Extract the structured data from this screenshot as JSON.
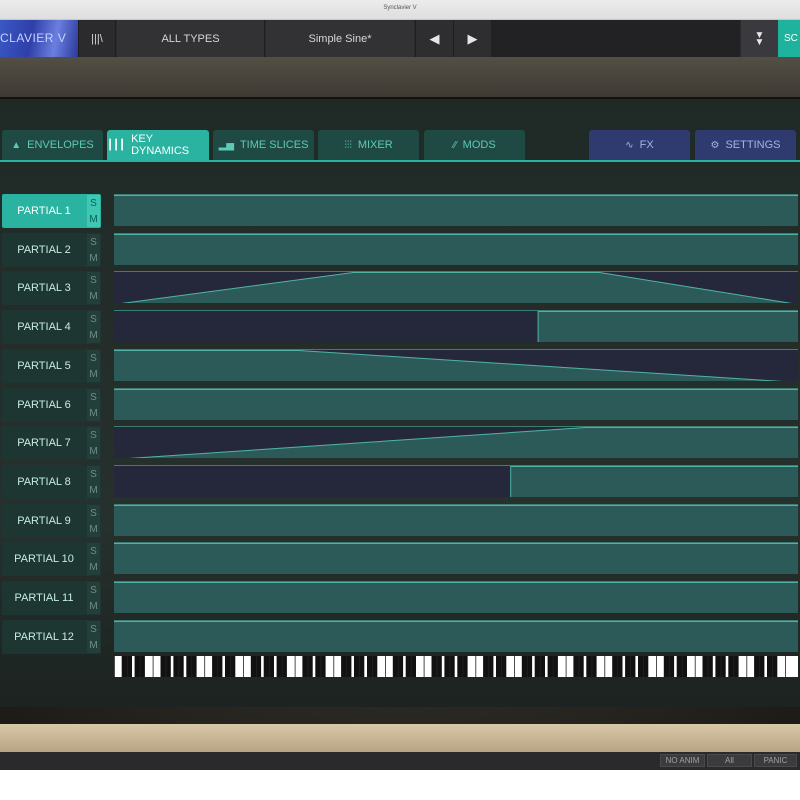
{
  "window": {
    "title": "Synclavier V"
  },
  "toolbar": {
    "logo": "CLAVIER V",
    "library_icon": "library-icon",
    "types_label": "ALL TYPES",
    "preset_name": "Simple Sine*",
    "prev_icon": "◀",
    "next_icon": "▶",
    "menu_icon": "chevron-down-icon",
    "sc_label": "SC"
  },
  "tabs": [
    {
      "label": "ENVELOPES",
      "icon": "mountain-icon",
      "active": false
    },
    {
      "label": "KEY DYNAMICS",
      "icon": "keyboard-icon",
      "active": true
    },
    {
      "label": "TIME SLICES",
      "icon": "bars-icon",
      "active": false
    },
    {
      "label": "MIXER",
      "icon": "faders-icon",
      "active": false
    },
    {
      "label": "MODS",
      "icon": "mods-icon",
      "active": false
    },
    {
      "label": "FX",
      "icon": "wave-icon",
      "active": false
    },
    {
      "label": "SETTINGS",
      "icon": "gear-icon",
      "active": false
    }
  ],
  "partials": [
    {
      "label": "PARTIAL 1",
      "solo": "S",
      "mute": "M",
      "selected": true
    },
    {
      "label": "PARTIAL 2",
      "solo": "S",
      "mute": "M"
    },
    {
      "label": "PARTIAL 3",
      "solo": "S",
      "mute": "M"
    },
    {
      "label": "PARTIAL 4",
      "solo": "S",
      "mute": "M"
    },
    {
      "label": "PARTIAL 5",
      "solo": "S",
      "mute": "M"
    },
    {
      "label": "PARTIAL 6",
      "solo": "S",
      "mute": "M"
    },
    {
      "label": "PARTIAL 7",
      "solo": "S",
      "mute": "M"
    },
    {
      "label": "PARTIAL 8",
      "solo": "S",
      "mute": "M"
    },
    {
      "label": "PARTIAL 9",
      "solo": "S",
      "mute": "M"
    },
    {
      "label": "PARTIAL 10",
      "solo": "S",
      "mute": "M"
    },
    {
      "label": "PARTIAL 11",
      "solo": "S",
      "mute": "M"
    },
    {
      "label": "PARTIAL 12",
      "solo": "S",
      "mute": "M"
    }
  ],
  "key_dynamics": [
    [
      [
        0,
        1
      ],
      [
        1,
        1
      ]
    ],
    [
      [
        0,
        1
      ],
      [
        1,
        1
      ]
    ],
    [
      [
        0,
        0
      ],
      [
        0.35,
        1
      ],
      [
        0.71,
        1
      ],
      [
        1,
        0
      ]
    ],
    [
      [
        0,
        0
      ],
      [
        0.62,
        0
      ],
      [
        0.62,
        1
      ],
      [
        1,
        1
      ]
    ],
    [
      [
        0,
        1
      ],
      [
        0.27,
        1
      ],
      [
        1,
        0
      ]
    ],
    [
      [
        0,
        1
      ],
      [
        1,
        1
      ]
    ],
    [
      [
        0,
        0
      ],
      [
        0.69,
        1
      ],
      [
        1,
        1
      ]
    ],
    [
      [
        0,
        0
      ],
      [
        0.58,
        0
      ],
      [
        0.58,
        1
      ],
      [
        1,
        1
      ]
    ],
    [
      [
        0,
        1
      ],
      [
        1,
        1
      ]
    ],
    [
      [
        0,
        1
      ],
      [
        1,
        1
      ]
    ],
    [
      [
        0,
        1
      ],
      [
        1,
        1
      ]
    ],
    [
      [
        0,
        1
      ],
      [
        1,
        1
      ]
    ]
  ],
  "status": {
    "no_anim": "NO ANIM",
    "all": "All",
    "panic": "PANIC"
  },
  "colors": {
    "accent": "#2ab3a0",
    "lane_fill": "#2c5a58",
    "lane_bg": "#25283b",
    "purple_tab": "#2f3b6e"
  }
}
